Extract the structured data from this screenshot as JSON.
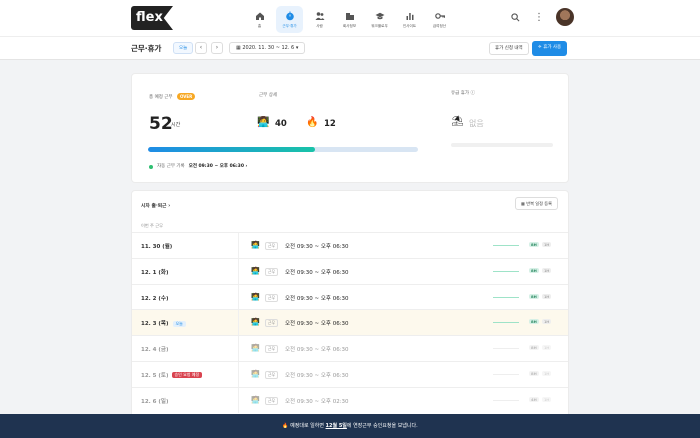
{
  "logo": "flex",
  "nav": [
    {
      "label": "홈",
      "icon": "home-icon",
      "active": false
    },
    {
      "label": "근무·휴가",
      "icon": "clock-icon",
      "active": true
    },
    {
      "label": "사람",
      "icon": "people-icon",
      "active": false
    },
    {
      "label": "회사정보",
      "icon": "building-icon",
      "active": false
    },
    {
      "label": "워크플로우",
      "icon": "graduation-cap-icon",
      "active": false
    },
    {
      "label": "인사이트",
      "icon": "bar-chart-icon",
      "active": false
    },
    {
      "label": "급여정산",
      "icon": "key-icon",
      "active": false
    }
  ],
  "subheader": {
    "title": "근무·휴가",
    "today": "오늘",
    "prev": "‹",
    "next": "›",
    "date_range": "2020. 11. 30 ~ 12. 6",
    "vacation_request": "휴가 신청 내역",
    "vacation_use": "휴가 사용"
  },
  "summary": {
    "planned_label": "총 예정 근무",
    "over_badge": "OVER",
    "hours": "52",
    "hours_unit": "시간",
    "detail_label": "근무 상세",
    "work_count": "40",
    "overtime_count": "12",
    "progress": 0.62,
    "plan_label": "자동 근무 기록",
    "plan_time": "오전 09:30 ~ 오후 06:30 ›",
    "leave_label": "유급 휴가",
    "leave_value": "없음"
  },
  "schedule": {
    "header": "시차 출·퇴근 ›",
    "register_button": "반복 일정 등록",
    "week_label": "이번 주 근무",
    "rows": [
      {
        "date": "11. 30 (월)",
        "kind": "근무",
        "time": "오전 09:30 ~ 오후 06:30",
        "b8": "8H",
        "b1": "1H",
        "dim": false,
        "highlight": false,
        "tag": "",
        "holiday": ""
      },
      {
        "date": "12. 1 (화)",
        "kind": "근무",
        "time": "오전 09:30 ~ 오후 06:30",
        "b8": "8H",
        "b1": "1H",
        "dim": false,
        "highlight": false,
        "tag": "",
        "holiday": ""
      },
      {
        "date": "12. 2 (수)",
        "kind": "근무",
        "time": "오전 09:30 ~ 오후 06:30",
        "b8": "8H",
        "b1": "1H",
        "dim": false,
        "highlight": false,
        "tag": "",
        "holiday": ""
      },
      {
        "date": "12. 3 (목)",
        "kind": "근무",
        "time": "오전 09:30 ~ 오후 06:30",
        "b8": "8H",
        "b1": "1H",
        "dim": false,
        "highlight": true,
        "tag": "오늘",
        "holiday": ""
      },
      {
        "date": "12. 4 (금)",
        "kind": "근무",
        "time": "오전 09:30 ~ 오후 06:30",
        "b8": "8H",
        "b1": "1H",
        "dim": true,
        "highlight": false,
        "tag": "",
        "holiday": ""
      },
      {
        "date": "12. 5 (토)",
        "kind": "근무",
        "time": "오전 09:30 ~ 오후 06:30",
        "b8": "8H",
        "b1": "1H",
        "dim": true,
        "highlight": false,
        "tag": "",
        "holiday": "승인 요청 예정"
      },
      {
        "date": "12. 6 (일)",
        "kind": "근무",
        "time": "오전 09:30 ~ 오후 02:30",
        "b8": "4H",
        "b1": "1H",
        "dim": true,
        "highlight": false,
        "tag": "",
        "holiday": ""
      }
    ]
  },
  "footer": {
    "prefix": "예정대로 일하면",
    "highlight": "12월 5일",
    "suffix": "에 연장근무 승인요청을 보냅니다."
  },
  "colors": {
    "accent": "#1f8ce6",
    "over": "#f7a823",
    "footer_bg": "#1f3350"
  }
}
